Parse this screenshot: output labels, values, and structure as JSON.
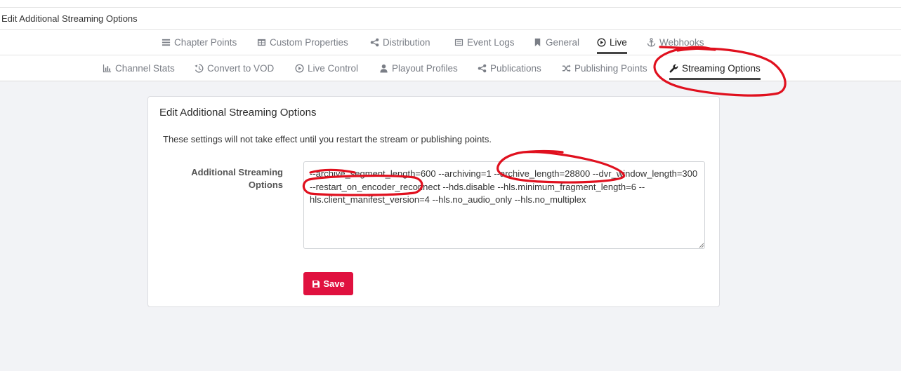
{
  "header": {
    "title": "Edit Additional Streaming Options"
  },
  "primary_tabs": [
    {
      "label": "Chapter Points",
      "icon": "list-icon"
    },
    {
      "label": "Custom Properties",
      "icon": "table-icon"
    },
    {
      "label": "Distribution",
      "icon": "share-icon"
    },
    {
      "label": "Event Logs",
      "icon": "log-icon"
    },
    {
      "label": "General",
      "icon": "bookmark-icon"
    },
    {
      "label": "Live",
      "icon": "play-circle-icon",
      "active": true
    },
    {
      "label": "Webhooks",
      "icon": "anchor-icon"
    }
  ],
  "secondary_tabs": [
    {
      "label": "Channel Stats",
      "icon": "bar-chart-icon"
    },
    {
      "label": "Convert to VOD",
      "icon": "history-icon"
    },
    {
      "label": "Live Control",
      "icon": "play-circle-icon"
    },
    {
      "label": "Playout Profiles",
      "icon": "user-icon"
    },
    {
      "label": "Publications",
      "icon": "share-icon"
    },
    {
      "label": "Publishing Points",
      "icon": "shuffle-icon"
    },
    {
      "label": "Streaming Options",
      "icon": "wrench-icon",
      "active": true
    }
  ],
  "card": {
    "title": "Edit Additional Streaming Options",
    "notice": "These settings will not take effect until you restart the stream or publishing points.",
    "field_label": "Additional Streaming Options",
    "field_value": "--archive_segment_length=600 --archiving=1 --archive_length=28800 --dvr_window_length=300 --restart_on_encoder_reconnect --hds.disable --hls.minimum_fragment_length=6 --hls.client_manifest_version=4 --hls.no_audio_only --hls.no_multiplex",
    "save_label": "Save"
  },
  "colors": {
    "accent": "#e0113f",
    "annotation": "#e0101e"
  }
}
